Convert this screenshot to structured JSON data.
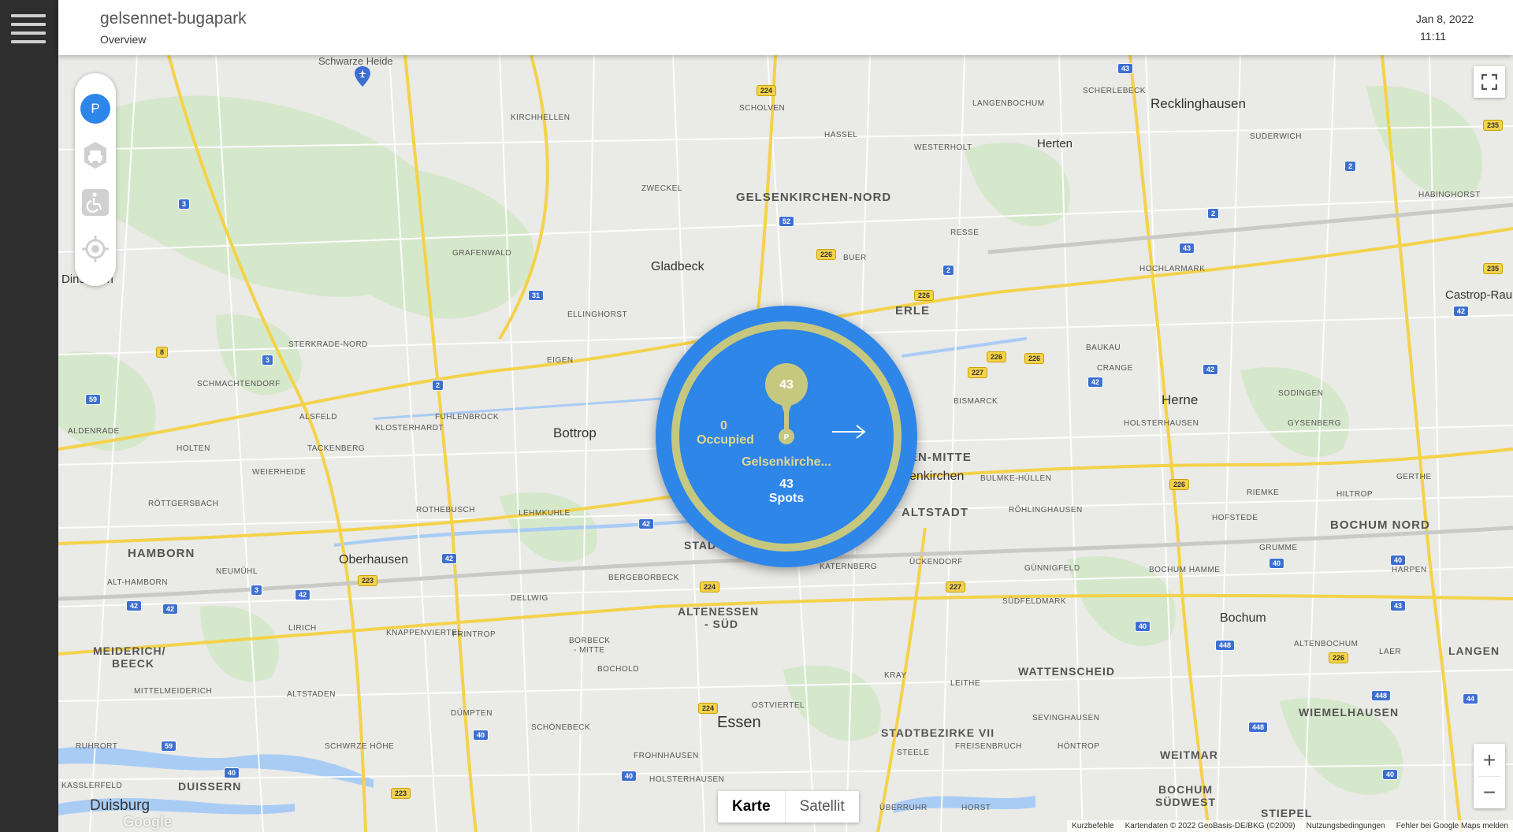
{
  "header": {
    "title": "gelsennet-bugapark",
    "subtitle": "Overview",
    "date": "Jan 8, 2022",
    "time": "11:11"
  },
  "toolbar": {
    "parking_label": "P",
    "icons": [
      "parking-icon",
      "car-icon",
      "wheelchair-icon",
      "locate-icon"
    ]
  },
  "map": {
    "labels": {
      "schwarze_heide": "Schwarze Heide",
      "recklinghausen": "Recklinghausen",
      "herten": "Herten",
      "gelsenkirchen_nord": "GELSENKIRCHEN-NORD",
      "gladbeck": "Gladbeck",
      "erle": "ERLE",
      "castrop": "Castrop-Rau",
      "bottrop": "Bottrop",
      "herne": "Herne",
      "en_mitte": "EN-MITTE",
      "enkirchen": "enkirchen",
      "altstadt": "ALTSTADT",
      "bochum_nord": "BOCHUM NORD",
      "hamborn": "HAMBORN",
      "oberhausen": "Oberhausen",
      "altenessen": "ALTENESSEN",
      "sued": "- SÜD",
      "bochum": "Bochum",
      "meiderich": "MEIDERICH/",
      "beeck": "BEECK",
      "wattenscheid": "WATTENSCHEID",
      "langen": "LANGEN",
      "essen": "Essen",
      "stadtbezirke": "STADTBEZIRKE VII",
      "wiemelhausen": "WIEMELHAUSEN",
      "weitmar": "WEITMAR",
      "duisburg": "Duisburg",
      "duissern": "DUISSERN",
      "bochum_suedwest": "BOCHUM",
      "suedwest": "SÜDWEST",
      "stiepel": "STIEPEL",
      "dinslaken": "Dinslaken",
      "scherlebeck": "SCHERLEBECK",
      "scholven": "SCHOLVEN",
      "langenbochum": "LANGENBOCHUM",
      "kirchhellen": "KIRCHHELLEN",
      "hassel": "HASSEL",
      "westerholt": "WESTERHOLT",
      "suderwich": "SUDERWICH",
      "zweckel": "ZWECKEL",
      "habinghorst": "HABINGHORST",
      "grafenwald": "GRAFENWALD",
      "buer": "BUER",
      "resse": "RESSE",
      "hochlarmark": "HOCHLARMARK",
      "ellinghorst": "ELLINGHORST",
      "sterkrade_nord": "STERKRADE-NORD",
      "eigen": "EIGEN",
      "baukau": "BAUKAU",
      "crange": "CRANGE",
      "schmachtendorf": "SCHMACHTENDORF",
      "alsfeld": "ALSFELD",
      "klosterhardt": "KLOSTERHARDT",
      "fuhlenbrock": "FUHLENBROCK",
      "bismarck": "BISMARCK",
      "sodingen": "SODINGEN",
      "aldenrade": "ALDENRADE",
      "holsterhausen": "HOLSTERHAUSEN",
      "gysenberg": "GYSENBERG",
      "holten": "HOLTEN",
      "tackenberg": "TACKENBERG",
      "bulmke": "BULMKE-HÜLLEN",
      "weierheide": "WEIERHEIDE",
      "gerthe": "GERTHE",
      "rottgersbach": "RÖTTGERSBACH",
      "rothebusch": "ROTHEBUSCH",
      "lehmkuhle": "LEHMKUHLE",
      "rohlinghausen": "RÖHLINGHAUSEN",
      "riemke": "RIEMKE",
      "hiltrop": "HILTROP",
      "hofstede": "HOFSTEDE",
      "grumme": "GRUMME",
      "harpen": "HARPEN",
      "alt_hamborn": "ALT-HAMBORN",
      "neumuhl": "NEUMÜHL",
      "bergeborbeck": "BERGEBORBECK",
      "uckendorf": "ÜCKENDORF",
      "gunnigfeld": "GÜNNIGFELD",
      "bochum_hamme": "BOCHUM HAMME",
      "dellwig": "DELLWIG",
      "sudfeldmark": "SÜDFELDMARK",
      "lirich": "LIRICH",
      "knappenviertel": "KNAPPENVIERTEL",
      "frintrop": "FRINTROP",
      "borbeck": "BORBECK",
      "mitte": "- MITTE",
      "altenbochum": "ALTENBOCHUM",
      "laer": "LAER",
      "bochold": "BOCHOLD",
      "kray": "KRAY",
      "leithe": "LEITHE",
      "mittelmeiderich": "MITTELMEIDERICH",
      "altstaden": "ALTSTADEN",
      "dumpten": "DÜMPTEN",
      "ostviertel": "OSTVIERTEL",
      "sevinghausen": "SEVINGHAUSEN",
      "schonebeck": "SCHÖNEBECK",
      "steele": "STEELE",
      "freisenbruch": "FREISENBRUCH",
      "hontrop": "HÖNTROP",
      "ruhrort": "RUHRORT",
      "schwurze": "SCHWRZE HÖHE",
      "frohnhausen": "FROHNHAUSEN",
      "holsterhausen2": "HOLSTERHAUSEN",
      "kasslerfeld": "KASSLERFELD",
      "horst": "HORST",
      "uberruhr": "ÜBERRUHR",
      "katernberg": "KATERNBERG",
      "stadt": "STAD"
    },
    "shields": [
      "43",
      "224",
      "235",
      "52",
      "2",
      "2",
      "3",
      "226",
      "31",
      "43",
      "235",
      "2",
      "226",
      "42",
      "8",
      "3",
      "227",
      "226",
      "226",
      "42",
      "42",
      "59",
      "2",
      "226",
      "42",
      "40",
      "40",
      "223",
      "42",
      "42",
      "42",
      "42",
      "3",
      "224",
      "227",
      "40",
      "448",
      "43",
      "226",
      "448",
      "44",
      "224",
      "59",
      "40",
      "40",
      "448",
      "40",
      "223",
      "40"
    ],
    "zoom_in": "+",
    "zoom_out": "−",
    "map_types": [
      "Karte",
      "Satellit"
    ],
    "active_map_type": "Karte",
    "google_logo": "Google",
    "attribution": [
      "Kurzbefehle",
      "Kartendaten © 2022 GeoBasis-DE/BKG (©2009)",
      "Nutzungsbedingungen",
      "Fehler bei Google Maps melden"
    ]
  },
  "cluster": {
    "occupied_count": "0",
    "occupied_label": "Occupied",
    "pin_count": "43",
    "pin_letter": "P",
    "name": "Gelsenkirche...",
    "spots_count": "43",
    "spots_label": "Spots"
  },
  "colors": {
    "sidebar": "#2e2e2e",
    "accent_blue": "#2f86e9",
    "ring_khaki": "#c7c87f",
    "road_yellow": "#f4d24a",
    "highway_shield": "#3d6fd0"
  }
}
